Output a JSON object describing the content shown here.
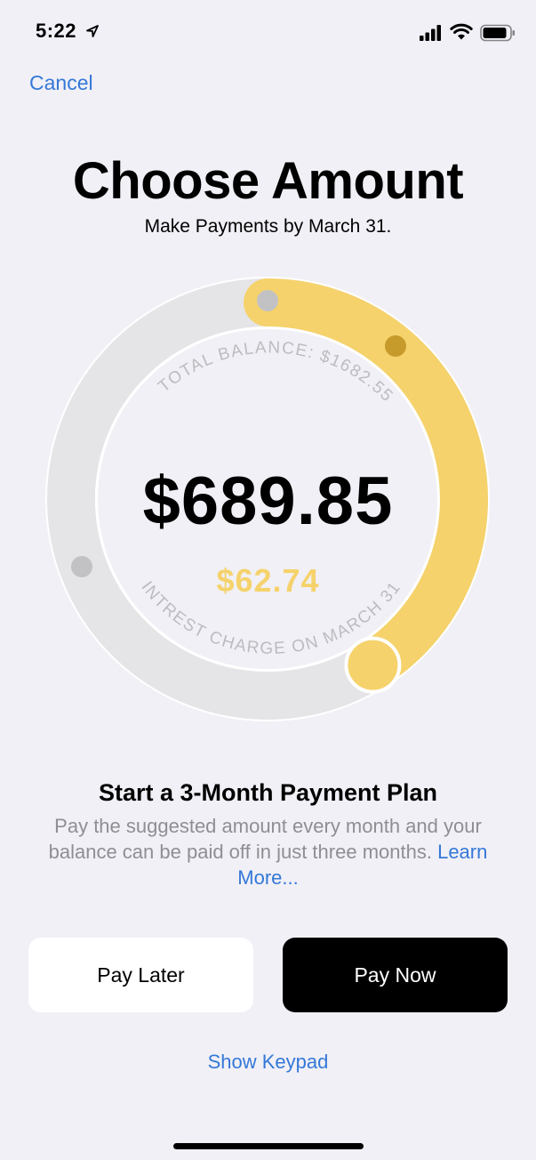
{
  "status_bar": {
    "time": "5:22"
  },
  "header": {
    "cancel_label": "Cancel"
  },
  "main": {
    "title": "Choose Amount",
    "subtitle": "Make Payments by March 31.",
    "dial": {
      "total_balance_label": "TOTAL BALANCE: $1682.55",
      "amount": "$689.85",
      "interest_amount": "$62.74",
      "interest_label": "INTREST CHARGE ON MARCH 31",
      "selected_fraction": 0.41,
      "colors": {
        "track": "#e5e5e8",
        "fill": "#f5d26b",
        "marker_gray": "#c2c2c5",
        "marker_gold": "#c79a2c"
      }
    },
    "plan": {
      "title": "Start a 3-Month Payment Plan",
      "description": "Pay the suggested amount every month and your balance can be paid off in just three months.",
      "learn_more": "Learn More..."
    }
  },
  "actions": {
    "pay_later_label": "Pay Later",
    "pay_now_label": "Pay Now",
    "show_keypad_label": "Show Keypad"
  },
  "colors": {
    "background": "#f1f0f6",
    "link": "#3478d8",
    "accent": "#f5d26b"
  }
}
